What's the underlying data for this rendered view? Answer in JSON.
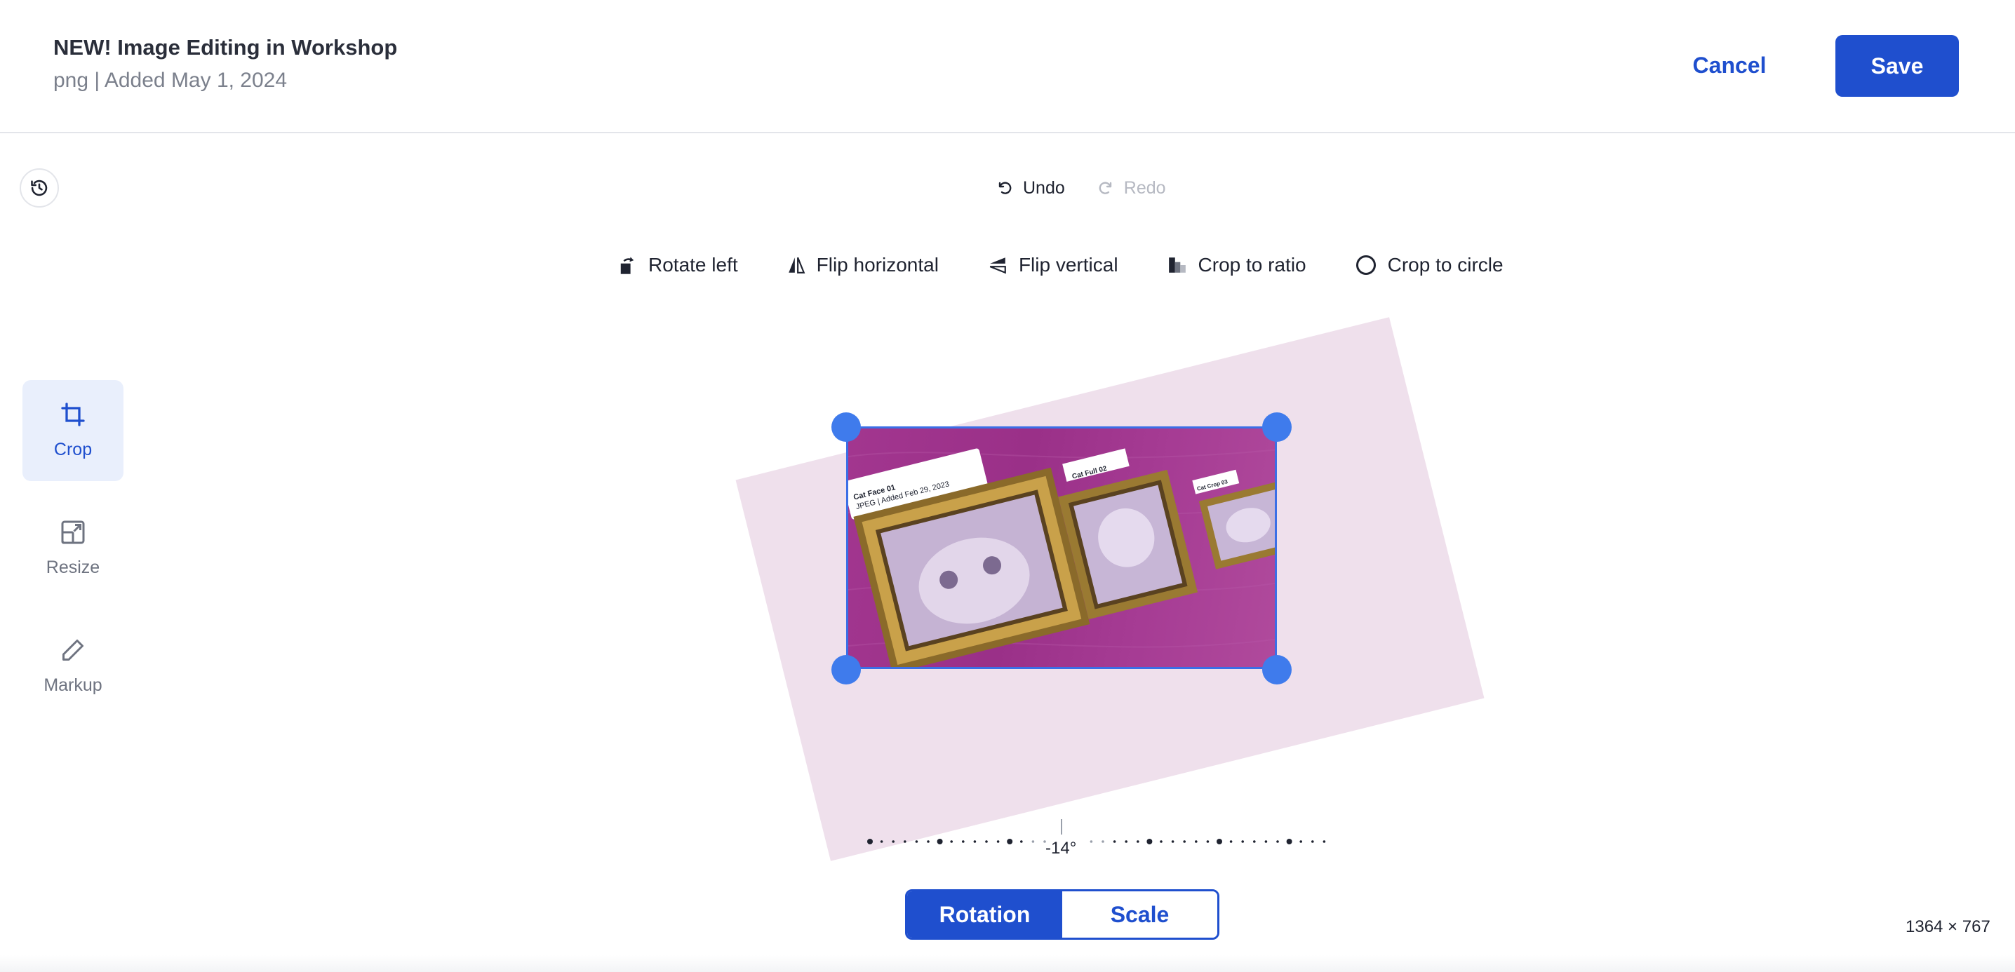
{
  "header": {
    "title": "NEW! Image Editing in Workshop",
    "subtitle": "png | Added May 1, 2024",
    "cancel_label": "Cancel",
    "save_label": "Save"
  },
  "history": {
    "undo_label": "Undo",
    "redo_label": "Redo"
  },
  "toolbar": {
    "rotate_left": "Rotate left",
    "flip_horizontal": "Flip horizontal",
    "flip_vertical": "Flip vertical",
    "crop_to_ratio": "Crop to ratio",
    "crop_to_circle": "Crop to circle"
  },
  "sidebar": {
    "items": [
      {
        "label": "Crop",
        "icon": "crop-icon",
        "active": true
      },
      {
        "label": "Resize",
        "icon": "resize-icon",
        "active": false
      },
      {
        "label": "Markup",
        "icon": "pencil-icon",
        "active": false
      }
    ]
  },
  "image": {
    "frame1_title": "Cat Face 01",
    "frame1_meta": "JPEG | Added Feb 29, 2023",
    "frame2_title": "Cat Full 02",
    "frame3_title": "Cat Crop 03"
  },
  "dial": {
    "value": "-14°"
  },
  "mode": {
    "rotation": "Rotation",
    "scale": "Scale",
    "selected": "Rotation"
  },
  "dimensions": "1364 × 767",
  "colors": {
    "accent": "#1f4fce",
    "handle": "#3f7bec",
    "image_bg": "#a2368f",
    "rotated_bg": "#efe0ec"
  }
}
